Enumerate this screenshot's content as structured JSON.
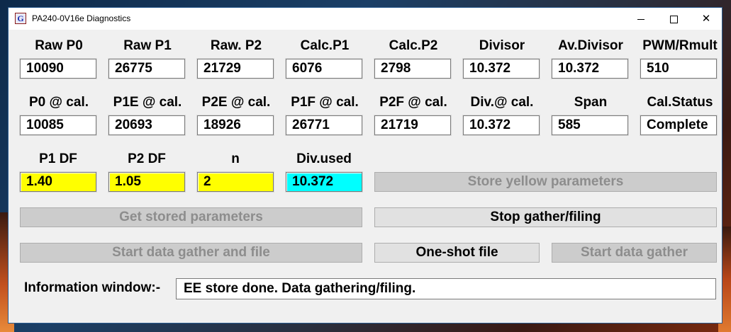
{
  "window": {
    "title": "PA240-0V16e Diagnostics",
    "app_icon": "G",
    "controls": {
      "minimize": "minimize-icon",
      "maximize": "maximize-icon",
      "close": "✕"
    }
  },
  "row1": {
    "labels": [
      "Raw P0",
      "Raw P1",
      "Raw. P2",
      "Calc.P1",
      "Calc.P2",
      "Divisor",
      "Av.Divisor",
      "PWM/Rmult"
    ],
    "values": [
      "10090",
      "26775",
      "21729",
      "6076",
      "2798",
      "10.372",
      "10.372",
      "510"
    ]
  },
  "row2": {
    "labels": [
      "P0 @ cal.",
      "P1E @ cal.",
      "P2E @ cal.",
      "P1F @ cal.",
      "P2F @ cal.",
      "Div.@ cal.",
      "Span",
      "Cal.Status"
    ],
    "values": [
      "10085",
      "20693",
      "18926",
      "26771",
      "21719",
      "10.372",
      "585",
      "Complete"
    ]
  },
  "row3": {
    "labels": [
      "P1 DF",
      "P2 DF",
      "n",
      "Div.used"
    ],
    "values": [
      "1.40",
      "1.05",
      "2",
      "10.372"
    ]
  },
  "colors": {
    "yellow": "#ffff00",
    "cyan": "#00ffff",
    "disabled_text": "#8d8d8d"
  },
  "buttons": {
    "store_yellow": "Store yellow parameters",
    "get_stored": "Get stored parameters",
    "stop_gather": "Stop gather/filing",
    "start_gather_file": "Start data gather and file",
    "one_shot": "One-shot file",
    "start_gather": "Start data gather"
  },
  "info": {
    "label": "Information window:-",
    "text": "EE store done. Data gathering/filing."
  }
}
